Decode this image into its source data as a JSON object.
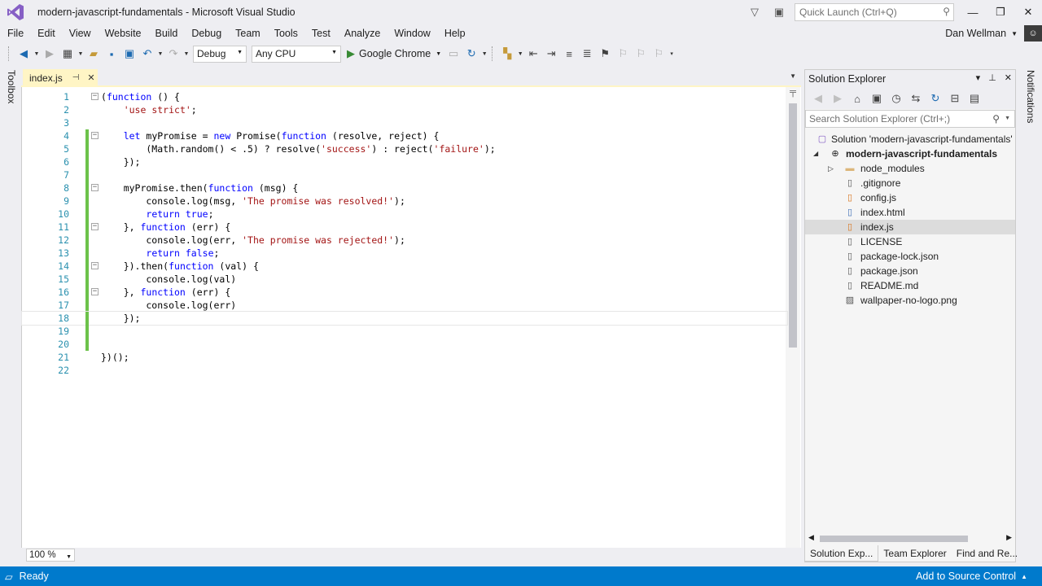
{
  "window": {
    "title": "modern-javascript-fundamentals - Microsoft Visual Studio",
    "quick_launch_placeholder": "Quick Launch (Ctrl+Q)"
  },
  "menu": {
    "items": [
      "File",
      "Edit",
      "View",
      "Website",
      "Build",
      "Debug",
      "Team",
      "Tools",
      "Test",
      "Analyze",
      "Window",
      "Help"
    ],
    "user": "Dan Wellman"
  },
  "toolbar": {
    "config": "Debug",
    "platform": "Any CPU",
    "run_target": "Google Chrome"
  },
  "sidebar": {
    "left_tab": "Toolbox",
    "right_tab": "Notifications"
  },
  "editor": {
    "tab_label": "index.js",
    "zoom": "100 %",
    "lines": [
      {
        "n": "1",
        "text": "(function () {",
        "fold": true
      },
      {
        "n": "2",
        "text": "    'use strict';"
      },
      {
        "n": "3",
        "text": ""
      },
      {
        "n": "4",
        "text": "    let myPromise = new Promise(function (resolve, reject) {",
        "fold": true,
        "changed": true
      },
      {
        "n": "5",
        "text": "        (Math.random() < .5) ? resolve('success') : reject('failure');",
        "changed": true
      },
      {
        "n": "6",
        "text": "    });",
        "changed": true
      },
      {
        "n": "7",
        "text": "",
        "changed": true
      },
      {
        "n": "8",
        "text": "    myPromise.then(function (msg) {",
        "fold": true,
        "changed": true
      },
      {
        "n": "9",
        "text": "        console.log(msg, 'The promise was resolved!');",
        "changed": true
      },
      {
        "n": "10",
        "text": "        return true;",
        "changed": true
      },
      {
        "n": "11",
        "text": "    }, function (err) {",
        "fold": true,
        "changed": true
      },
      {
        "n": "12",
        "text": "        console.log(err, 'The promise was rejected!');",
        "changed": true
      },
      {
        "n": "13",
        "text": "        return false;",
        "changed": true
      },
      {
        "n": "14",
        "text": "    }).then(function (val) {",
        "fold": true,
        "changed": true
      },
      {
        "n": "15",
        "text": "        console.log(val)",
        "changed": true
      },
      {
        "n": "16",
        "text": "    }, function (err) {",
        "fold": true,
        "changed": true
      },
      {
        "n": "17",
        "text": "        console.log(err)",
        "changed": true
      },
      {
        "n": "18",
        "text": "    });",
        "changed": true,
        "current": true
      },
      {
        "n": "19",
        "text": "",
        "changed": true
      },
      {
        "n": "20",
        "text": "",
        "changed": true
      },
      {
        "n": "21",
        "text": "})();"
      },
      {
        "n": "22",
        "text": ""
      }
    ]
  },
  "solution_explorer": {
    "title": "Solution Explorer",
    "search_placeholder": "Search Solution Explorer (Ctrl+;)",
    "solution": "Solution 'modern-javascript-fundamentals'",
    "project": "modern-javascript-fundamentals",
    "items": [
      {
        "label": "node_modules",
        "icon": "folder-icon",
        "expandable": true
      },
      {
        "label": ".gitignore",
        "icon": "file-icon"
      },
      {
        "label": "config.js",
        "icon": "js-file-icon"
      },
      {
        "label": "index.html",
        "icon": "html-file-icon"
      },
      {
        "label": "index.js",
        "icon": "js-file-icon",
        "selected": true
      },
      {
        "label": "LICENSE",
        "icon": "file-icon"
      },
      {
        "label": "package-lock.json",
        "icon": "json-file-icon"
      },
      {
        "label": "package.json",
        "icon": "json-file-icon"
      },
      {
        "label": "README.md",
        "icon": "file-icon"
      },
      {
        "label": "wallpaper-no-logo.png",
        "icon": "image-file-icon"
      }
    ],
    "bottom_tabs": [
      "Solution Exp...",
      "Team Explorer",
      "Find and Re..."
    ]
  },
  "status": {
    "left": "Ready",
    "right": "Add to Source Control"
  },
  "colors": {
    "accent": "#007acc",
    "tab_active": "#fff5c5",
    "change_bar": "#6cc24a",
    "keyword": "#0000ff",
    "string": "#a31515",
    "line_number": "#2b91af"
  }
}
